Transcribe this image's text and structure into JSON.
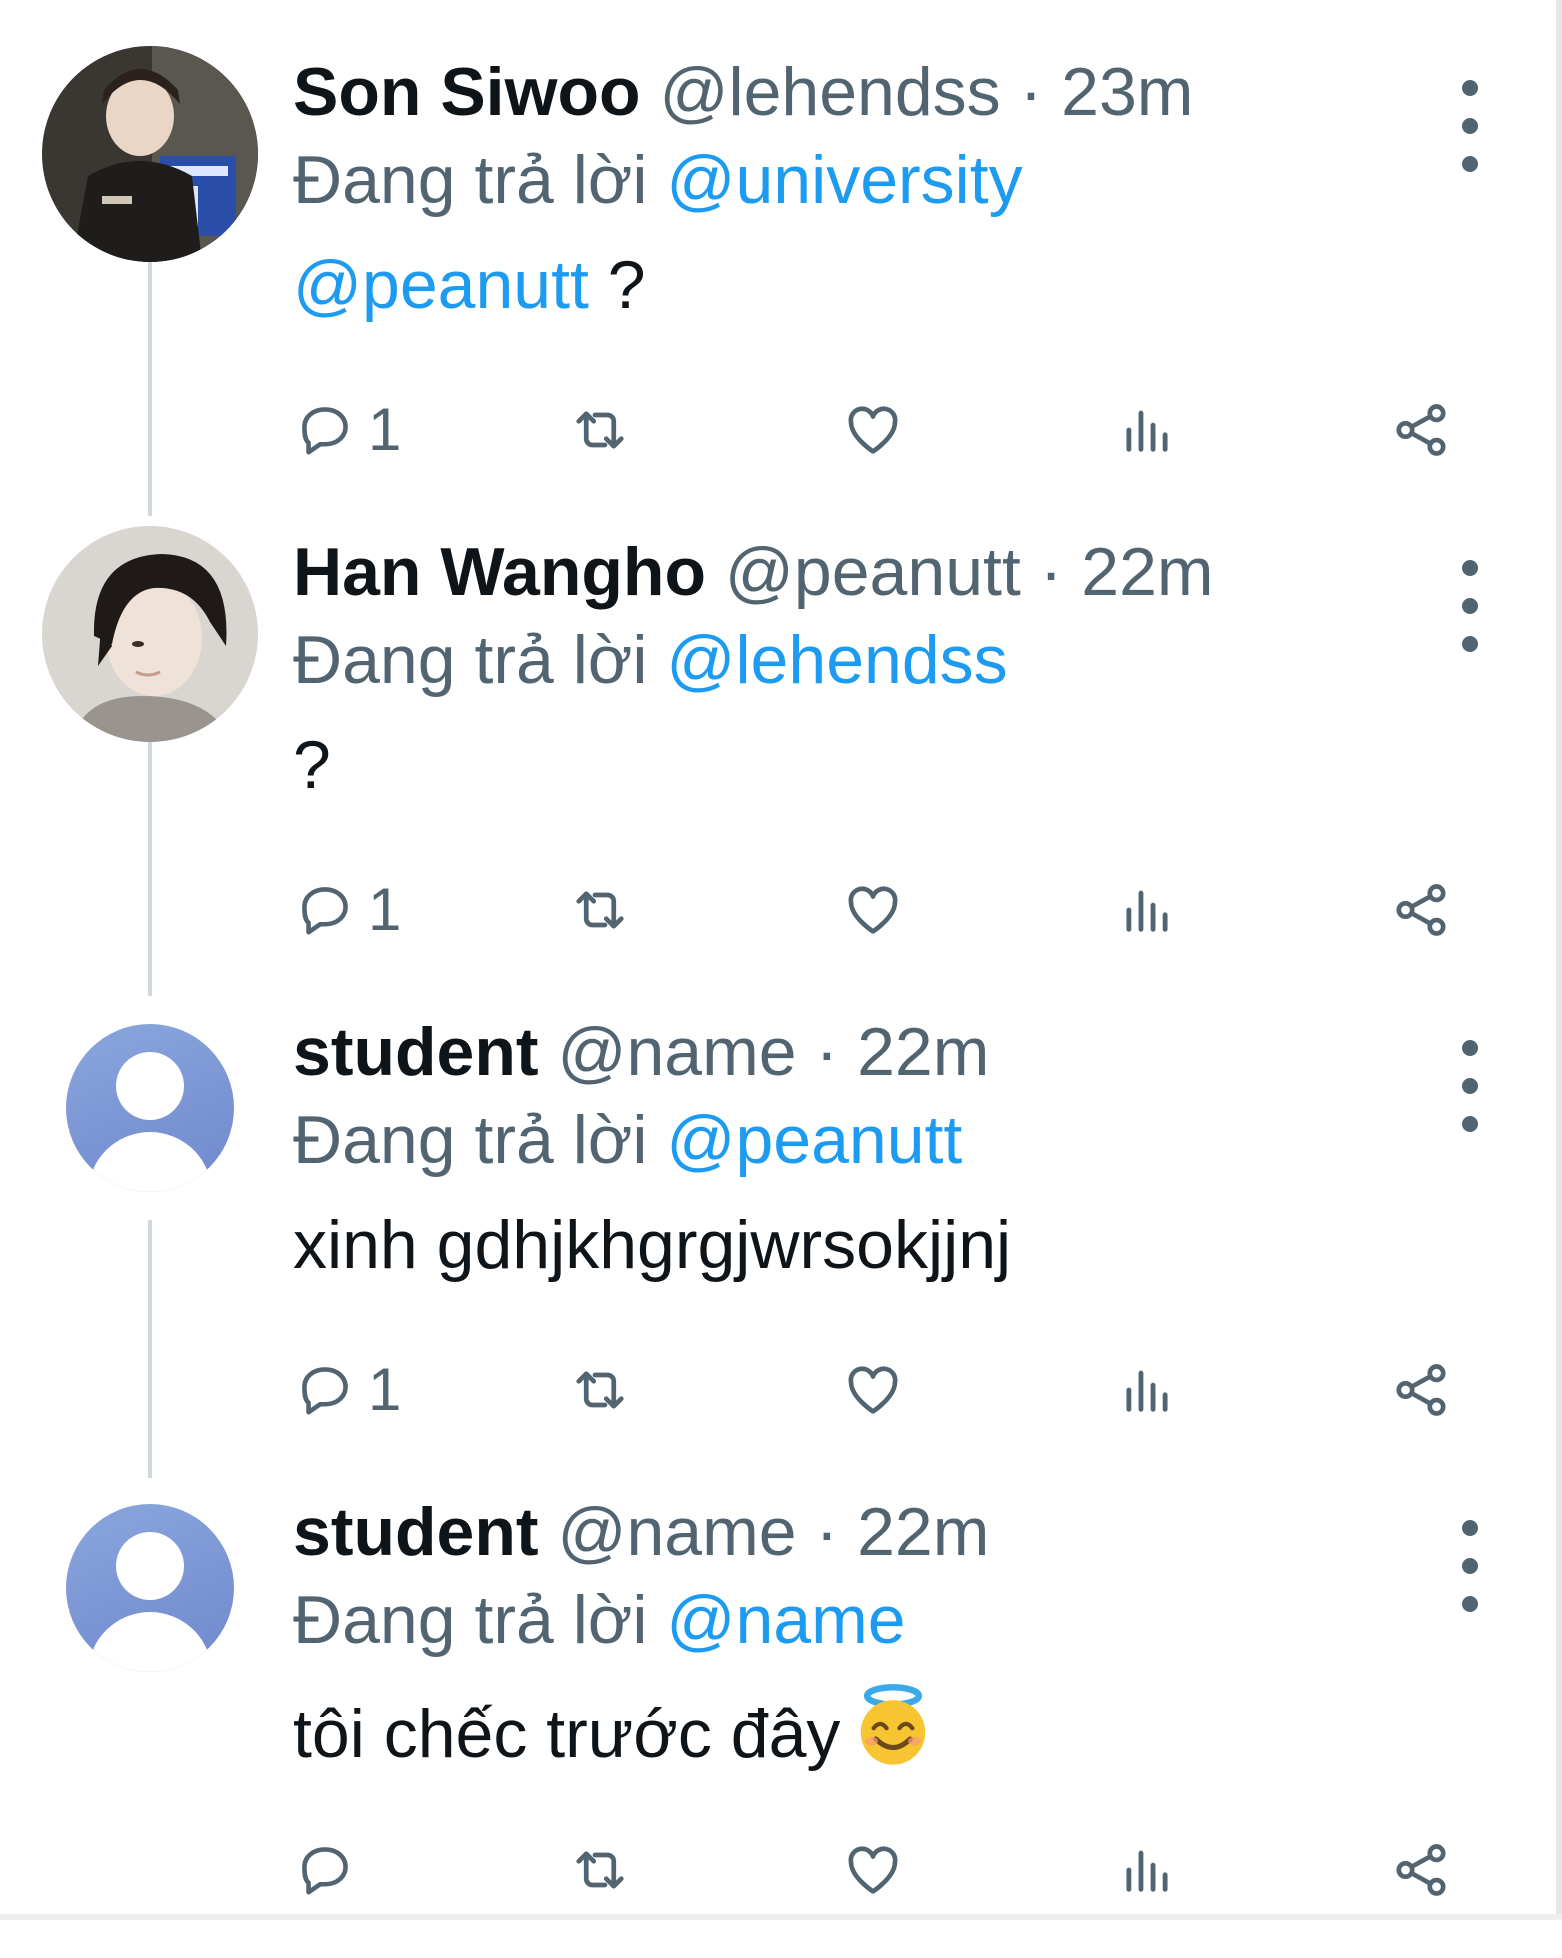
{
  "tweets": [
    {
      "name": "Son Siwoo",
      "handle": "@lehendss",
      "sep": "·",
      "time": "23m",
      "replying_label": "Đang trả lời",
      "replying_to": "@university",
      "body_mention": "@peanutt",
      "body_text": " ?",
      "reply_count": "1",
      "avatar": "photo-person-dark-jacket"
    },
    {
      "name": "Han Wangho",
      "handle": "@peanutt",
      "sep": "·",
      "time": "22m",
      "replying_label": "Đang trả lời",
      "replying_to": "@lehendss",
      "body_mention": "",
      "body_text": "?",
      "reply_count": "1",
      "avatar": "photo-person-dark-hair"
    },
    {
      "name": "student",
      "handle": "@name",
      "sep": "·",
      "time": "22m",
      "replying_label": "Đang trả lời",
      "replying_to": "@peanutt",
      "body_mention": "",
      "body_text": "xinh gdhjkhgrgjwrsokjjnj",
      "reply_count": "1",
      "avatar": "default-user-icon"
    },
    {
      "name": "student",
      "handle": "@name",
      "sep": "·",
      "time": "22m",
      "replying_label": "Đang trả lời",
      "replying_to": "@name",
      "body_mention": "",
      "body_text": "tôi chếc trước đây",
      "reply_count": "",
      "avatar": "default-user-icon",
      "emoji": "smiling-face-with-halo"
    }
  ],
  "colors": {
    "accent": "#1d9bf0",
    "muted": "#536471",
    "text": "#0f1419",
    "thread_line": "#cfd9de"
  }
}
